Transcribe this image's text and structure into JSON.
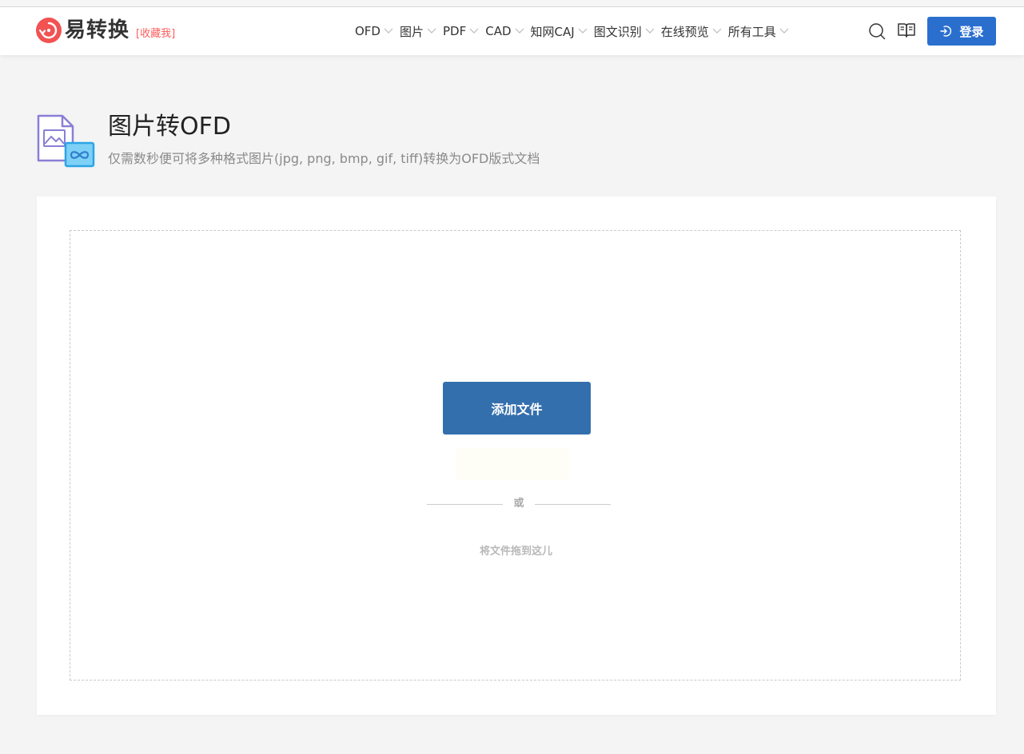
{
  "brand": {
    "name": "易转换",
    "bookmark": "[收藏我]"
  },
  "nav": [
    {
      "label": "OFD"
    },
    {
      "label": "图片"
    },
    {
      "label": "PDF"
    },
    {
      "label": "CAD"
    },
    {
      "label": "知网CAJ"
    },
    {
      "label": "图文识别"
    },
    {
      "label": "在线预览"
    },
    {
      "label": "所有工具"
    }
  ],
  "header": {
    "login_label": "登录",
    "icons": [
      "search-icon",
      "book-icon",
      "login-icon"
    ]
  },
  "page": {
    "title": "图片转OFD",
    "subtitle": "仅需数秒便可将多种格式图片(jpg, png, bmp, gif, tiff)转换为OFD版式文档"
  },
  "upload": {
    "add_file_label": "添加文件",
    "or_label": "或",
    "drag_hint": "将文件拖到这儿"
  },
  "colors": {
    "accent": "#2a6fce",
    "add_button": "#346fad",
    "brand_red": "#f25252"
  }
}
